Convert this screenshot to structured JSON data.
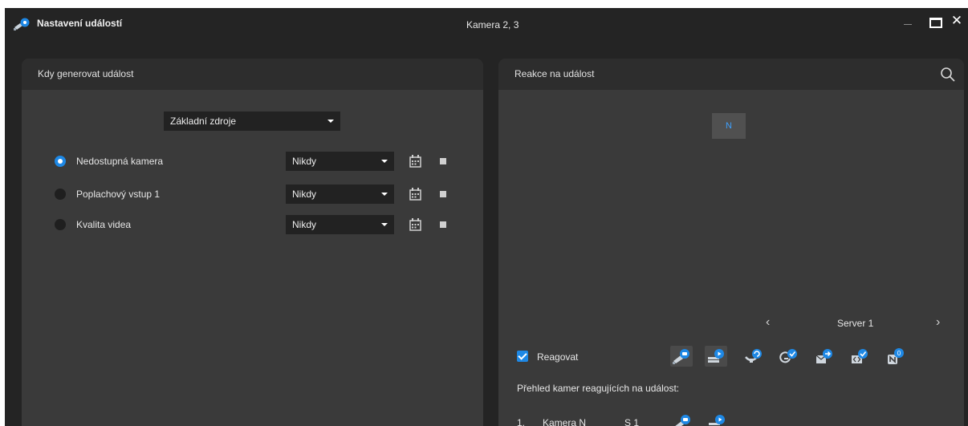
{
  "window": {
    "title": "Nastavení událostí",
    "subtitle": "Kamera 2, 3",
    "close_glyph": "✕"
  },
  "left_panel": {
    "header": "Kdy generovat událost",
    "source_select": {
      "value": "Základní zdroje"
    },
    "events": [
      {
        "label": "Nedostupná kamera",
        "selected": true,
        "schedule": "Nikdy"
      },
      {
        "label": "Poplachový vstup 1",
        "selected": false,
        "schedule": "Nikdy"
      },
      {
        "label": "Kvalita videa",
        "selected": false,
        "schedule": "Nikdy"
      }
    ]
  },
  "right_panel": {
    "header": "Reakce na událost",
    "node_label": "N",
    "pager": {
      "label": "Server 1",
      "prev": "‹",
      "next": "›"
    },
    "react_checkbox": {
      "label": "Reagovat",
      "checked": true
    },
    "action_icons": [
      "camera-event-icon",
      "recorder-play-icon",
      "ptz-preset-icon",
      "output-check-icon",
      "email-send-icon",
      "script-check-icon",
      "notification-counter-icon"
    ],
    "notification_count": "0",
    "overview_title": "Přehled kamer reagujících na událost:",
    "cameras": [
      {
        "index": "1.",
        "name": "Kamera N",
        "server": "S 1"
      }
    ]
  },
  "colors": {
    "background": "#242424",
    "panel": "#3a3a3a",
    "panel_header": "#2d2d2d",
    "accent": "#1e88e5",
    "dropdown": "#222222"
  }
}
